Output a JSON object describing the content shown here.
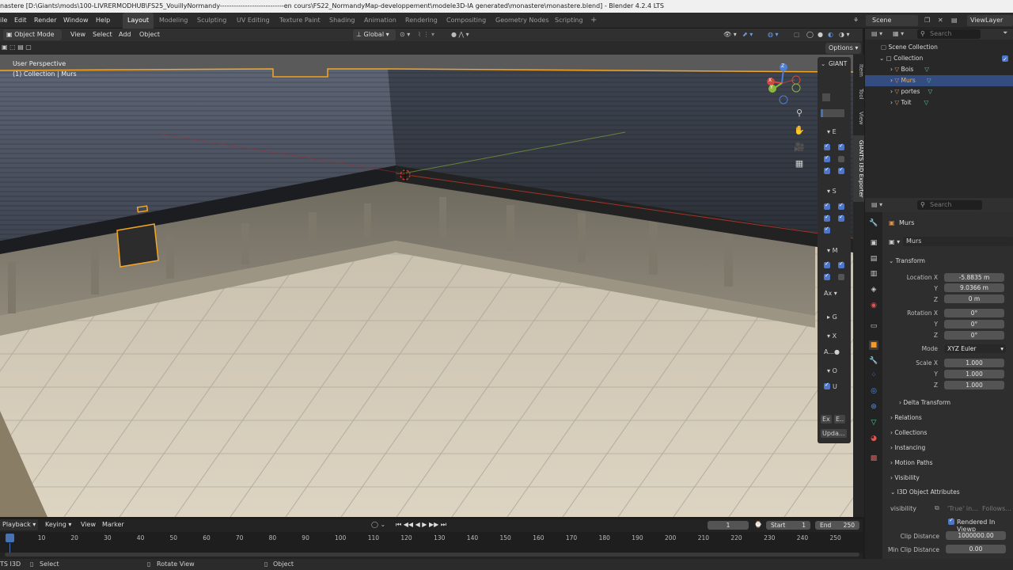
{
  "window": {
    "title": "nastere [D:\\Giants\\mods\\100-LIVRERMODHUB\\FS25_VouillyNormandy----------------------------en cours\\FS22_NormandyMap-developpement\\modele3D-IA generated\\monastere\\monastere.blend] - Blender 4.2.4 LTS"
  },
  "menu": {
    "file": "ile",
    "edit": "Edit",
    "render": "Render",
    "window": "Window",
    "help": "Help"
  },
  "workspaces": [
    "Layout",
    "Modeling",
    "Sculpting",
    "UV Editing",
    "Texture Paint",
    "Shading",
    "Animation",
    "Rendering",
    "Compositing",
    "Geometry Nodes",
    "Scripting"
  ],
  "add_workspace": "+",
  "scene": {
    "label": "Scene",
    "viewlayer": "ViewLayer"
  },
  "header3d": {
    "mode": "Object Mode",
    "view": "View",
    "select": "Select",
    "add": "Add",
    "object": "Object",
    "orientation": "Global",
    "options": "Options"
  },
  "viewport": {
    "perspective": "User Perspective",
    "collection": "(1) Collection | Murs"
  },
  "gizmo": {
    "z": "Z",
    "x": "X",
    "y": "Y"
  },
  "npanel": {
    "title": "GIANT",
    "e": "E",
    "s": "S",
    "m": "M",
    "ax": "Ax",
    "g": "G",
    "x": "X",
    "a": "A...",
    "o": "O",
    "u": "U",
    "ex": "Ex",
    "e2": "E..",
    "upd": "Upda..."
  },
  "sidebar_tabs": [
    "Item",
    "Tool",
    "View",
    "GIANTS I3D Exporter"
  ],
  "outliner": {
    "search": "Search",
    "root": "Scene Collection",
    "collection": "Collection",
    "items": [
      "Bois",
      "Murs",
      "portes",
      "Toit"
    ]
  },
  "props": {
    "search": "Search",
    "object_name": "Murs",
    "data_name": "Murs",
    "transform": "Transform",
    "location_x_label": "Location X",
    "location_y_label": "Y",
    "location_z_label": "Z",
    "loc_x": "-5.8835 m",
    "loc_y": "9.0366 m",
    "loc_z": "0 m",
    "rotation_x_label": "Rotation X",
    "rotation_y_label": "Y",
    "rotation_z_label": "Z",
    "rot_x": "0°",
    "rot_y": "0°",
    "rot_z": "0°",
    "mode_label": "Mode",
    "mode": "XYZ Euler",
    "scale_x_label": "Scale X",
    "scale_y_label": "Y",
    "scale_z_label": "Z",
    "sc_x": "1.000",
    "sc_y": "1.000",
    "sc_z": "1.000",
    "sections": [
      "Delta Transform",
      "Relations",
      "Collections",
      "Instancing",
      "Motion Paths",
      "Visibility",
      "I3D Object Attributes"
    ],
    "visibility_label": "visibility",
    "visibility_val": "'True' in...",
    "follows": "Follows...",
    "rendered": "Rendered In Viewp",
    "clip_label": "Clip Distance",
    "clip_val": "1000000.00",
    "minclip_label": "Min Clip Distance",
    "minclip_val": "0.00"
  },
  "timeline": {
    "playback": "Playback",
    "keying": "Keying",
    "view": "View",
    "marker": "Marker",
    "frame": "1",
    "start_label": "Start",
    "start": "1",
    "end_label": "End",
    "end": "250",
    "ticks": [
      "1",
      "10",
      "20",
      "30",
      "40",
      "50",
      "60",
      "70",
      "80",
      "90",
      "100",
      "110",
      "120",
      "130",
      "140",
      "150",
      "160",
      "170",
      "180",
      "190",
      "200",
      "210",
      "220",
      "230",
      "240",
      "250"
    ]
  },
  "status": {
    "left": "TS I3D",
    "select": "Select",
    "rotate": "Rotate View",
    "object": "Object"
  },
  "colors": {
    "accent": "#4772b3",
    "selection": "#f5a623",
    "active_row": "#334d80"
  }
}
